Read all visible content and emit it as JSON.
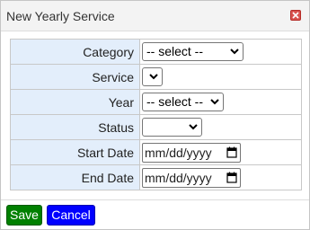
{
  "dialog": {
    "title": "New Yearly Service",
    "close_icon": "close-x-icon"
  },
  "form": {
    "category": {
      "label": "Category",
      "value": "-- select --"
    },
    "service": {
      "label": "Service",
      "value": ""
    },
    "year": {
      "label": "Year",
      "value": "-- select --"
    },
    "status": {
      "label": "Status",
      "value": ""
    },
    "start_date": {
      "label": "Start Date",
      "placeholder": "mm/dd/yyyy"
    },
    "end_date": {
      "label": "End Date",
      "placeholder": "mm/dd/yyyy"
    }
  },
  "buttons": {
    "save_label": "Save",
    "cancel_label": "Cancel"
  },
  "colors": {
    "label_bg": "#e3eefb",
    "save_bg": "#008000",
    "cancel_bg": "#0000ff",
    "close_bg": "#d9534f"
  }
}
